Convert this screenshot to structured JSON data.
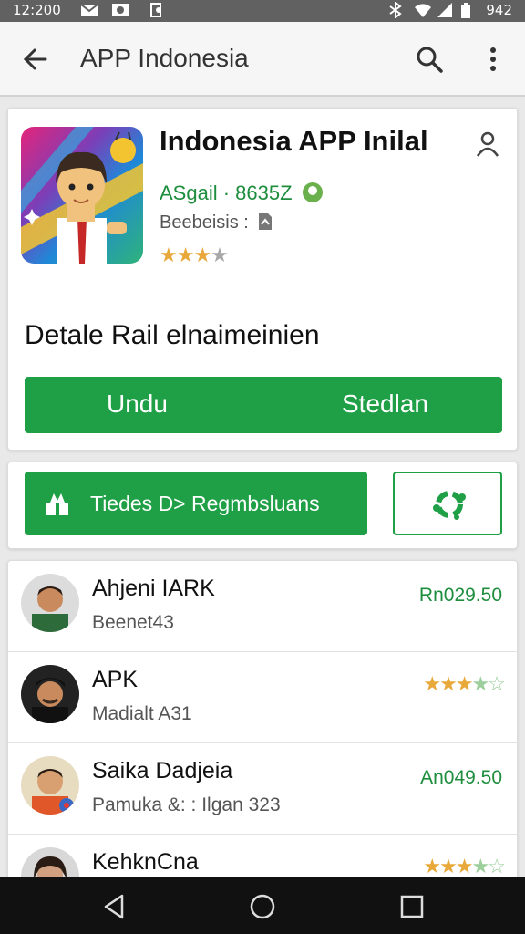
{
  "status_bar": {
    "time": "12:200",
    "battery_text": "942",
    "icons": [
      "mail-icon",
      "image-icon",
      "notification-icon",
      "bluetooth-icon",
      "wifi-icon",
      "signal-icon",
      "battery-icon"
    ]
  },
  "app_bar": {
    "title": "APP Indonesia",
    "icons": [
      "back-arrow-icon",
      "search-icon",
      "more-vert-icon"
    ]
  },
  "app_card": {
    "title": "Indonesia APP Inilal",
    "developer": "ASgail · 8635Z",
    "category": "Beebeisis :",
    "rating": 3.5,
    "rating_max": 5,
    "description": "Detale Rail elnaimeinien",
    "install_left": "Undu",
    "install_right": "Stedlan",
    "colors": {
      "green": "#1fa046",
      "star": "#e8a93a"
    }
  },
  "actions": {
    "primary_label": "Tiedes D> Regmbsluans",
    "icons": [
      "gift-icon",
      "share-icon"
    ]
  },
  "list": [
    {
      "name": "Ahjeni IARK",
      "sub": "Beenet43",
      "price": "Rn029.50",
      "avatar": "avatar-man-green"
    },
    {
      "name": "APK",
      "sub": "Madialt A31",
      "rating": 3.5,
      "avatar": "avatar-man-cap"
    },
    {
      "name": "Saika Dadjeia",
      "sub": "Pamuka &: : Ilgan 323",
      "price": "An049.50",
      "avatar": "avatar-man-orange"
    },
    {
      "name": "KehknCna",
      "sub": "",
      "rating": 3.5,
      "avatar": "avatar-woman"
    }
  ],
  "nav_bar": {
    "icons": [
      "back-triangle-icon",
      "home-circle-icon",
      "recents-square-icon"
    ]
  }
}
